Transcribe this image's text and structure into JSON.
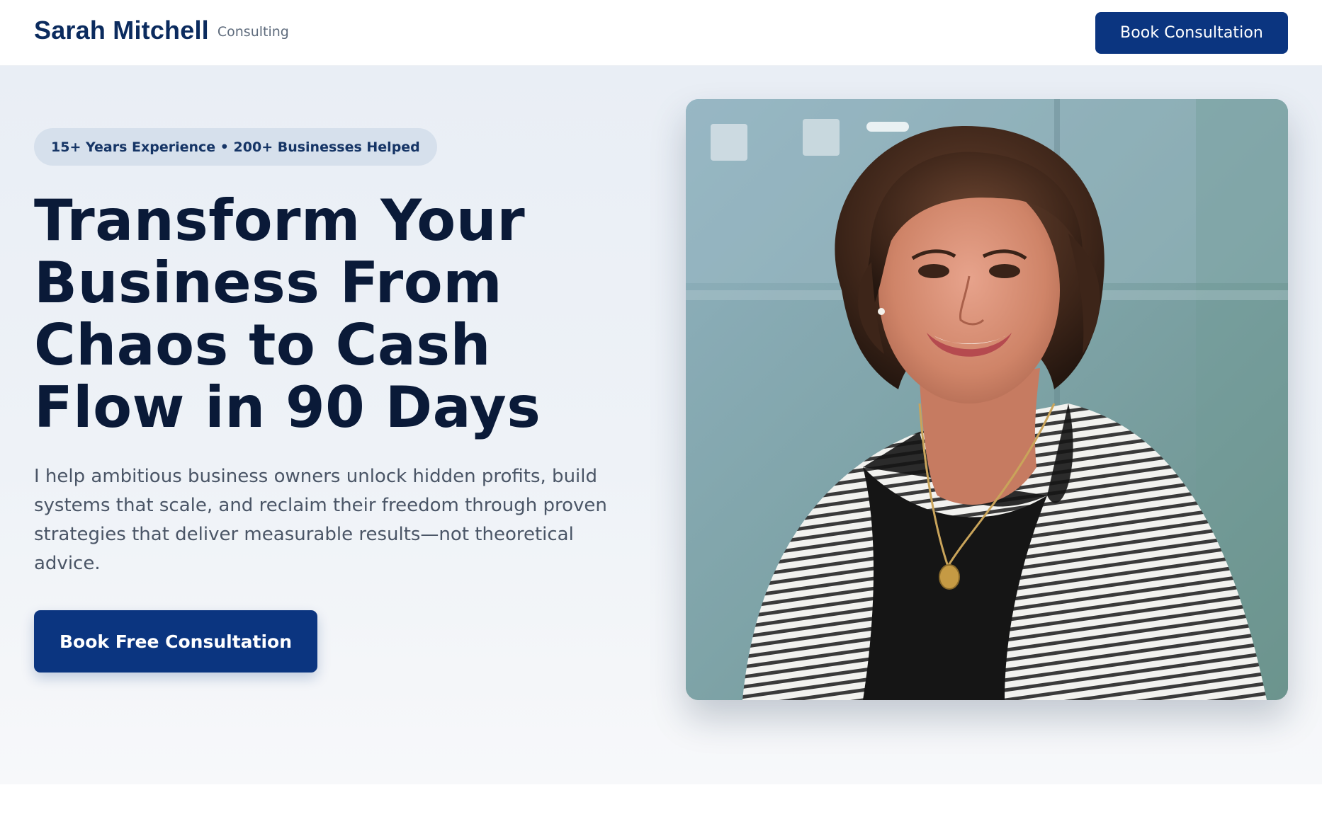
{
  "header": {
    "brand_name": "Sarah Mitchell",
    "brand_tagline": "Consulting",
    "cta_label": "Book Consultation"
  },
  "hero": {
    "badge": "15+ Years Experience • 200+ Businesses Helped",
    "headline_lines": [
      "Transform Your",
      "Business From",
      "Chaos to Cash",
      "Flow in 90 Days"
    ],
    "lede": "I help ambitious business owners unlock hidden profits, build systems that scale, and reclaim their freedom through proven strategies that deliver measurable results—not theoretical advice.",
    "cta_label": "Book Free Consultation"
  },
  "colors": {
    "brand_navy": "#0b3580",
    "heading_ink": "#0a1a38",
    "badge_bg": "#d6e0ec"
  }
}
